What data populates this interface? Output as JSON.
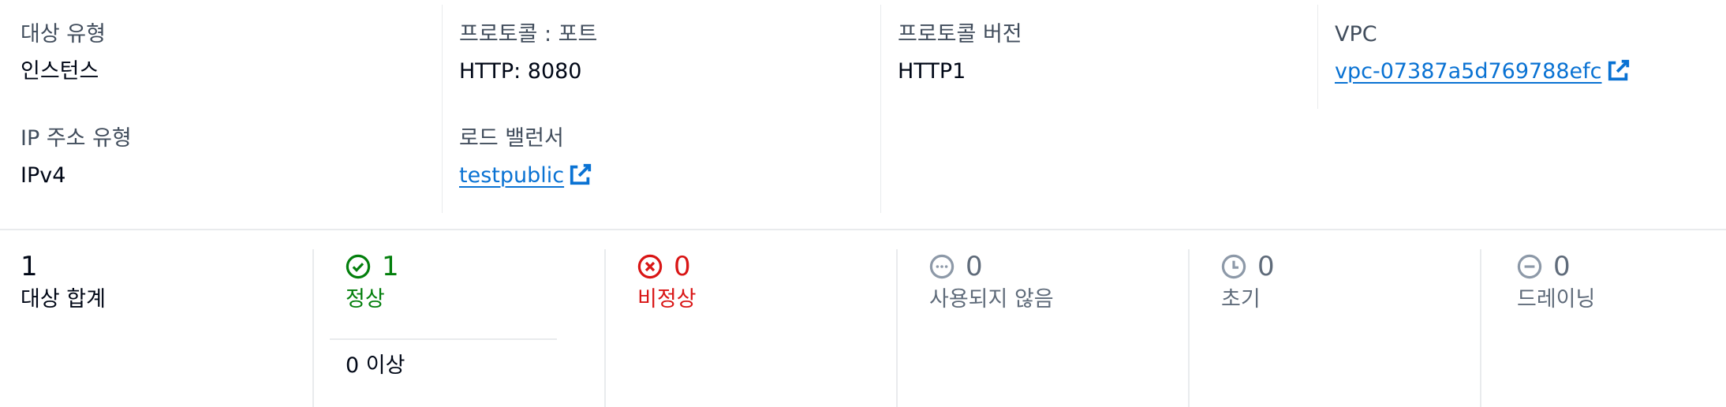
{
  "details": {
    "target_type": {
      "label": "대상 유형",
      "value": "인스턴스"
    },
    "protocol_port": {
      "label": "프로토콜 : 포트",
      "value": "HTTP: 8080"
    },
    "protocol_version": {
      "label": "프로토콜 버전",
      "value": "HTTP1"
    },
    "vpc": {
      "label": "VPC",
      "value": "vpc-07387a5d769788efc",
      "icon": "external-link-icon"
    },
    "ip_address_type": {
      "label": "IP 주소 유형",
      "value": "IPv4"
    },
    "load_balancer": {
      "label": "로드 밸런서",
      "value": "testpublic",
      "icon": "external-link-icon"
    }
  },
  "stats": {
    "total": {
      "value": "1",
      "label": "대상 합계"
    },
    "healthy": {
      "value": "1",
      "label": "정상",
      "icon": "status-positive-icon",
      "color": "#037f0c",
      "anomalous": "0 이상"
    },
    "unhealthy": {
      "value": "0",
      "label": "비정상",
      "icon": "status-negative-icon",
      "color": "#d91515"
    },
    "unused": {
      "value": "0",
      "label": "사용되지 않음",
      "icon": "status-stopped-icon",
      "color": "#8d99a8"
    },
    "initial": {
      "value": "0",
      "label": "초기",
      "icon": "status-pending-icon",
      "color": "#8d99a8"
    },
    "draining": {
      "value": "0",
      "label": "드레이닝",
      "icon": "status-draining-icon",
      "color": "#8d99a8"
    }
  },
  "colors": {
    "link": "#0972d3",
    "label": "#414d5c",
    "divider": "#e9ebed"
  }
}
